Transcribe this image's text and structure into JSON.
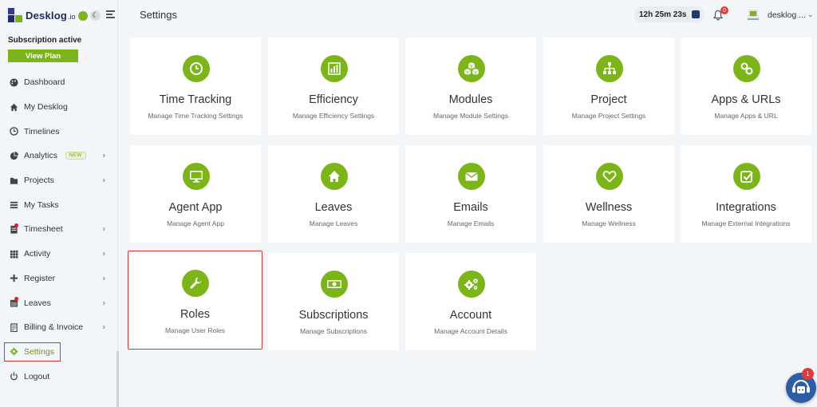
{
  "brand": {
    "name": "Desklog",
    "suffix": ".io"
  },
  "subscription": {
    "status": "Subscription active",
    "button": "View Plan"
  },
  "sidebar": {
    "items": [
      {
        "label": "Dashboard",
        "icon": "palette-icon"
      },
      {
        "label": "My Desklog",
        "icon": "home-icon"
      },
      {
        "label": "Timelines",
        "icon": "clock-icon"
      },
      {
        "label": "Analytics",
        "icon": "pie-chart-icon",
        "badge": "NEW"
      },
      {
        "label": "Projects",
        "icon": "folder-icon"
      },
      {
        "label": "My Tasks",
        "icon": "list-icon"
      },
      {
        "label": "Timesheet",
        "icon": "timesheet-icon"
      },
      {
        "label": "Activity",
        "icon": "grid-icon"
      },
      {
        "label": "Register",
        "icon": "plus-icon"
      },
      {
        "label": "Leaves",
        "icon": "calendar-icon"
      },
      {
        "label": "Billing & Invoice",
        "icon": "invoice-icon"
      },
      {
        "label": "Settings",
        "icon": "gear-icon"
      },
      {
        "label": "Logout",
        "icon": "power-icon"
      }
    ]
  },
  "header": {
    "title": "Settings",
    "timer": "12h 25m 23s",
    "notifications": "0",
    "user": "desklog ..."
  },
  "cards": [
    {
      "title": "Time Tracking",
      "subtitle": "Manage Time Tracking Settings"
    },
    {
      "title": "Efficiency",
      "subtitle": "Manage Efficiency Settings"
    },
    {
      "title": "Modules",
      "subtitle": "Manage Module Settings"
    },
    {
      "title": "Project",
      "subtitle": "Manage Project Settings"
    },
    {
      "title": "Apps & URLs",
      "subtitle": "Manage Apps & URL"
    },
    {
      "title": "Agent App",
      "subtitle": "Manage Agent App"
    },
    {
      "title": "Leaves",
      "subtitle": "Manage Leaves"
    },
    {
      "title": "Emails",
      "subtitle": "Manage Emails"
    },
    {
      "title": "Wellness",
      "subtitle": "Manage Wellness"
    },
    {
      "title": "Integrations",
      "subtitle": "Manage External Integrations"
    },
    {
      "title": "Roles",
      "subtitle": "Manage User Roles"
    },
    {
      "title": "Subscriptions",
      "subtitle": "Manage Subscriptions"
    },
    {
      "title": "Account",
      "subtitle": "Manage Account Details"
    }
  ],
  "chat": {
    "badge": "1"
  },
  "colors": {
    "accent": "#7cb518",
    "brand_dark": "#1c2a5c",
    "highlight": "#e03030"
  }
}
